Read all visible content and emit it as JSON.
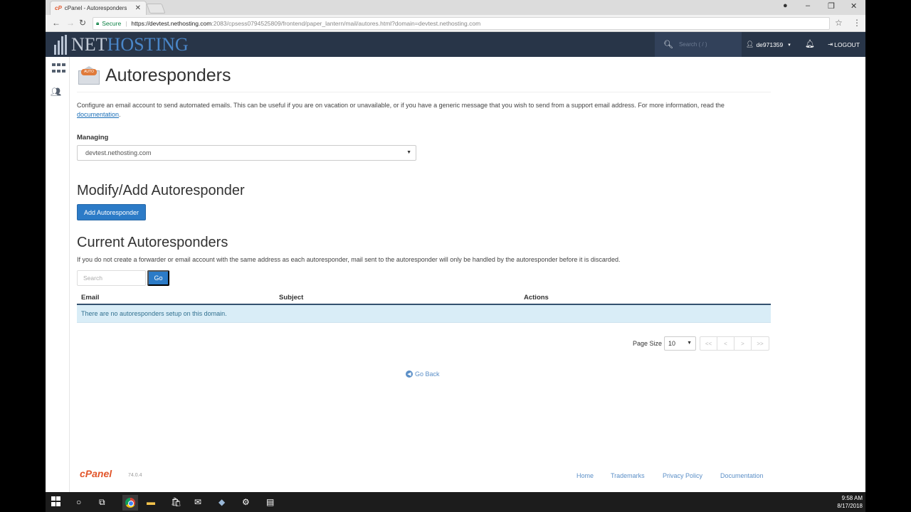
{
  "browser": {
    "tab_title": "cPanel - Autoresponders",
    "tab_favicon": "cP",
    "secure_label": "Secure",
    "url_host": "https://devtest.nethosting.com",
    "url_path": ":2083/cpsess0794525809/frontend/paper_lantern/mail/autores.html?domain=devtest.nethosting.com"
  },
  "header": {
    "logo_net": "NET",
    "logo_hosting": "HOSTING",
    "search_placeholder": "Search ( / )",
    "username": "de971359",
    "logout_label": "LOGOUT"
  },
  "page": {
    "title": "Autoresponders",
    "icon_badge": "AUTO",
    "description_before": "Configure an email account to send automated emails. This can be useful if you are on vacation or unavailable, or if you have a generic message that you wish to send from a support email address. For more information, read the ",
    "description_link": "documentation",
    "description_after": ".",
    "managing_label": "Managing",
    "managing_value": "devtest.nethosting.com",
    "modify_heading": "Modify/Add Autoresponder",
    "add_button": "Add Autoresponder",
    "current_heading": "Current Autoresponders",
    "current_note": "If you do not create a forwarder or email account with the same address as each autoresponder, mail sent to the autoresponder will only be handled by the autoresponder before it is discarded.",
    "search_placeholder": "Search",
    "go_button": "Go",
    "table_headers": [
      "Email",
      "Subject",
      "Actions"
    ],
    "empty_message": "There are no autoresponders setup on this domain.",
    "page_size_label": "Page Size",
    "page_size_value": "10",
    "pager": [
      "<<",
      "<",
      ">",
      ">>"
    ],
    "go_back": "Go Back"
  },
  "footer": {
    "logo": "cPanel",
    "version": "74.0.4",
    "links": [
      "Home",
      "Trademarks",
      "Privacy Policy",
      "Documentation"
    ]
  },
  "taskbar": {
    "time": "9:58 AM",
    "date": "8/17/2018"
  },
  "colors": {
    "header_bg": "#283548",
    "primary": "#2c7bc7",
    "cpanel_orange": "#e2562b",
    "info_row": "#d9edf7"
  }
}
